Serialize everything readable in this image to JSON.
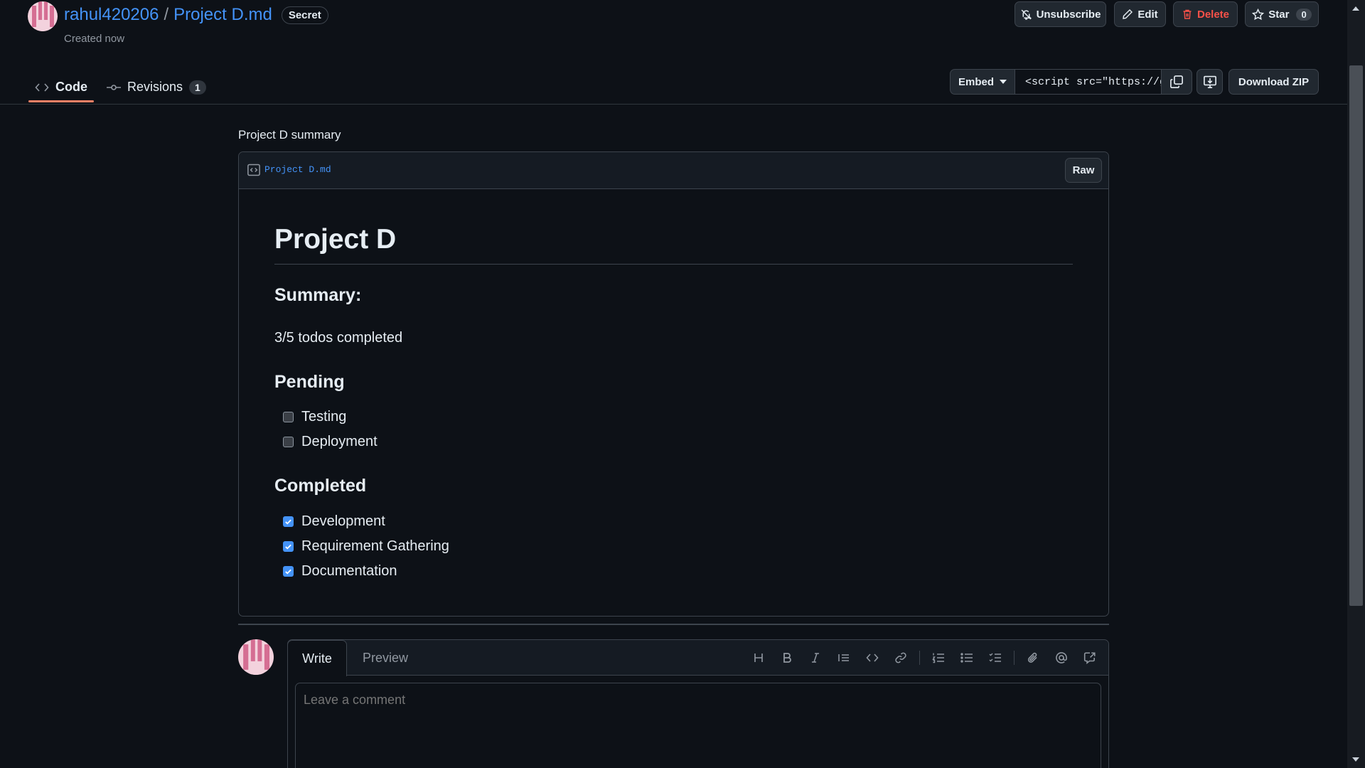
{
  "header": {
    "owner": "rahul420206",
    "separator": "/",
    "gist_name": "Project D.md",
    "visibility_badge": "Secret",
    "created": "Created now",
    "actions": {
      "unsubscribe": "Unsubscribe",
      "edit": "Edit",
      "delete": "Delete",
      "star": "Star",
      "star_count": "0"
    }
  },
  "tabs": {
    "code": "Code",
    "revisions": "Revisions",
    "revisions_count": "1"
  },
  "embed": {
    "select_label": "Embed",
    "snippet": "<script src=\"https://gist.github.com",
    "download_zip": "Download ZIP"
  },
  "gist": {
    "description": "Project D summary",
    "file_name": "Project D.md",
    "raw_label": "Raw"
  },
  "markdown": {
    "title": "Project D",
    "summary_heading": "Summary:",
    "summary_text": "3/5 todos completed",
    "pending_heading": "Pending",
    "pending_items": [
      {
        "label": "Testing",
        "checked": false
      },
      {
        "label": "Deployment",
        "checked": false
      }
    ],
    "completed_heading": "Completed",
    "completed_items": [
      {
        "label": "Development",
        "checked": true
      },
      {
        "label": "Requirement Gathering",
        "checked": true
      },
      {
        "label": "Documentation",
        "checked": true
      }
    ]
  },
  "comment": {
    "write_tab": "Write",
    "preview_tab": "Preview",
    "placeholder": "Leave a comment",
    "toolbar_icons": [
      "heading-icon",
      "bold-icon",
      "italic-icon",
      "quote-icon",
      "code-icon",
      "link-icon",
      "numbered-list-icon",
      "unordered-list-icon",
      "task-list-icon",
      "attach-icon",
      "mention-icon",
      "reference-icon"
    ]
  },
  "colors": {
    "background": "#0d1117",
    "link": "#4493f8",
    "danger": "#f85149",
    "tab_underline": "#f78166",
    "checkbox_checked": "#4493f8"
  }
}
